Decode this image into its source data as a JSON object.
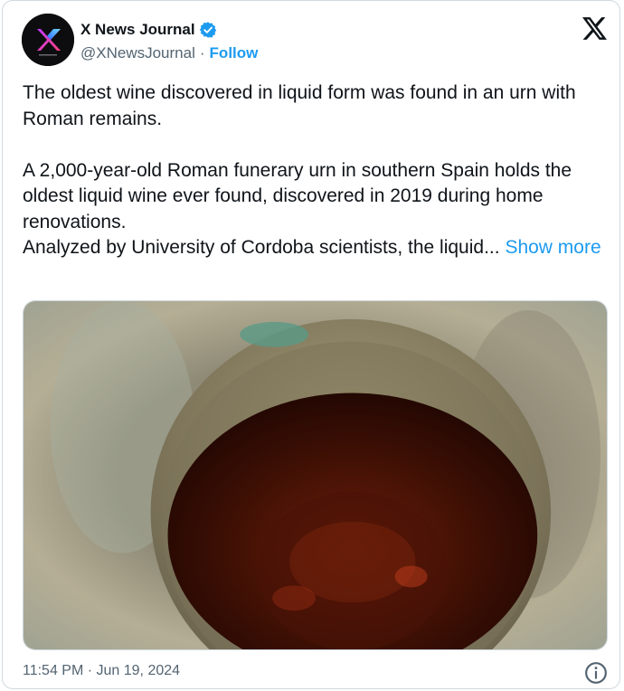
{
  "author": {
    "display_name": "X News Journal",
    "handle": "@XNewsJournal",
    "separator": "·",
    "follow_label": "Follow",
    "verified": true
  },
  "brand": {
    "logo_icon": "x-logo-icon"
  },
  "tweet": {
    "paragraph1": "The oldest wine discovered in liquid form was found in an urn with Roman remains.",
    "paragraph2": "A 2,000-year-old Roman funerary urn in southern Spain holds the oldest liquid wine ever found, discovered in 2019 during home renovations.",
    "paragraph3_text": "Analyzed by University of Cordoba scientists, the liquid...",
    "show_more_label": "Show more",
    "media_icon": "photo-urn-wine"
  },
  "footer": {
    "timestamp": "11:54 PM · Jun 19, 2024",
    "info_icon": "info-icon"
  },
  "colors": {
    "accent": "#1d9bf0",
    "text_primary": "#0f1419",
    "text_secondary": "#536471",
    "border": "#cfd9de",
    "verified": "#1d9bf0"
  }
}
